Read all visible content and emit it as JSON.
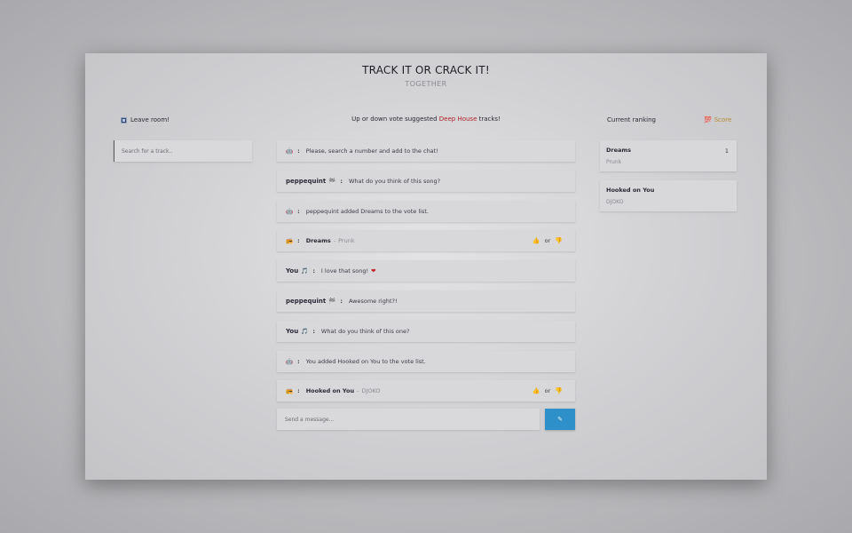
{
  "header": {
    "title": "TRACK IT OR CRACK IT!",
    "subtitle": "TOGETHER"
  },
  "sidebar": {
    "leave_label": "Leave room!",
    "search_placeholder": "Search for a track.."
  },
  "prompt": {
    "prefix": "Up or down vote suggested",
    "genre": "Deep House",
    "suffix": "tracks!"
  },
  "chat": {
    "messages": [
      {
        "emoji": "🤖",
        "sender": "",
        "text": "Please, search a number and add to the chat!"
      },
      {
        "emoji": "🏁",
        "sender": "peppequint",
        "text": "What do you think of this song?"
      },
      {
        "emoji": "🤖",
        "sender": "",
        "text": "peppequint added Dreams to the vote list."
      },
      {
        "emoji": "📻",
        "track": "Dreams",
        "artist": "Prunk",
        "votes": {
          "up": "👍",
          "or": "or",
          "down": "👎"
        }
      },
      {
        "emoji": "🎵",
        "sender": "You",
        "text": "I love that song!",
        "heart": "❤"
      },
      {
        "emoji": "🏁",
        "sender": "peppequint",
        "text": "Awesome right?!"
      },
      {
        "emoji": "🎵",
        "sender": "You",
        "text": "What do you think of this one?"
      },
      {
        "emoji": "🤖",
        "sender": "",
        "text": "You added Hooked on You to the vote list."
      },
      {
        "emoji": "📻",
        "track": "Hooked on You",
        "artist": "DJOKO",
        "votes": {
          "up": "👍",
          "or": "or",
          "down": "👎"
        }
      }
    ],
    "input_placeholder": "Send a message...",
    "send_icon": "✎"
  },
  "ranking": {
    "title": "Current ranking",
    "score_label": "Score",
    "score_icon": "💯",
    "items": [
      {
        "track": "Dreams",
        "artist": "Prunk",
        "score": "1"
      },
      {
        "track": "Hooked on You",
        "artist": "DJOKO",
        "score": ""
      }
    ]
  },
  "colors": {
    "accent": "#2d90c8",
    "genre": "#b0202a",
    "score": "#b58a30"
  }
}
